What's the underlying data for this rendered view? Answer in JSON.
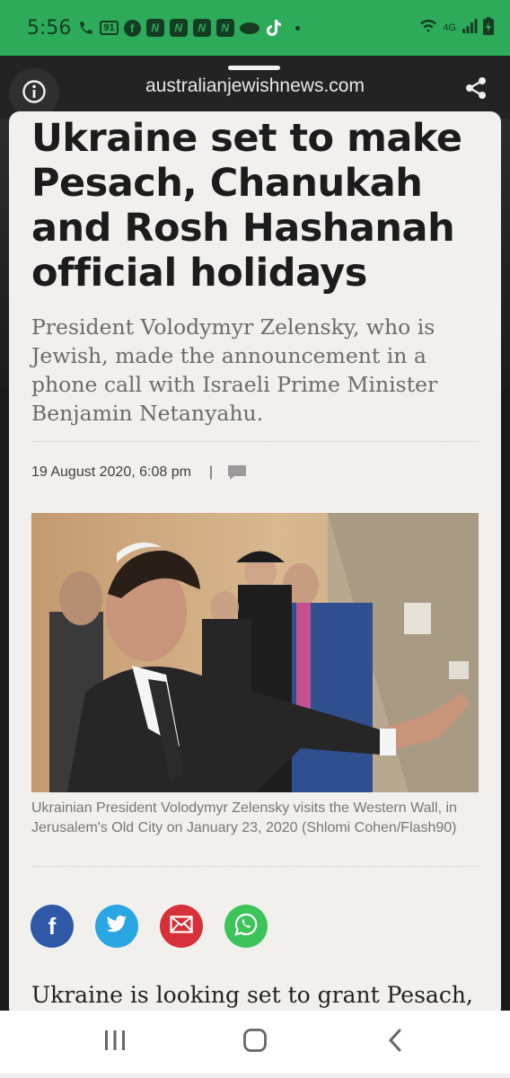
{
  "status_bar": {
    "time": "5:56",
    "badge": "91",
    "network": "4G",
    "icons": [
      "phone-icon",
      "badge-icon",
      "facebook-notification-icon",
      "n-app-icon",
      "n-app-icon",
      "n-app-icon",
      "n-app-icon",
      "cloud-icon",
      "tiktok-icon",
      "dot-icon",
      "wifi-icon",
      "network-icon",
      "signal-icon",
      "battery-icon"
    ]
  },
  "browser": {
    "url": "australianjewishnews.com",
    "info_icon": "info-icon",
    "share_icon": "share-icon"
  },
  "article": {
    "headline": "Ukraine set to make Pesach, Chanukah and Rosh Hashanah official holidays",
    "standfirst": "President Volodymyr Zelensky, who is Jewish, made the announcement in a phone call with Israeli Prime Minister Benjamin Netanyahu.",
    "date": "19 August 2020, 6:08 pm",
    "separator": "|",
    "comment_icon": "comment-icon",
    "caption": "Ukrainian President Volodymyr Zelensky visits the Western Wall, in Jerusalem's Old City on January 23, 2020 (Shlomi Cohen/Flash90)",
    "share_buttons": [
      {
        "name": "facebook",
        "label": "f",
        "color": "#2f58a6"
      },
      {
        "name": "twitter",
        "icon": "twitter-icon",
        "color": "#2aa6e3"
      },
      {
        "name": "email",
        "icon": "mail-icon",
        "color": "#d6303a"
      },
      {
        "name": "whatsapp",
        "icon": "whatsapp-icon",
        "color": "#3cc45b"
      }
    ],
    "body_first_line": "Ukraine is looking set to grant Pesach,"
  },
  "nav": {
    "recents_icon": "recents-icon",
    "home_icon": "home-icon",
    "back_icon": "back-icon"
  },
  "colors": {
    "status_bar": "#2daa5a",
    "browser_bar": "#232323",
    "article_bg": "#f1f0ed"
  }
}
